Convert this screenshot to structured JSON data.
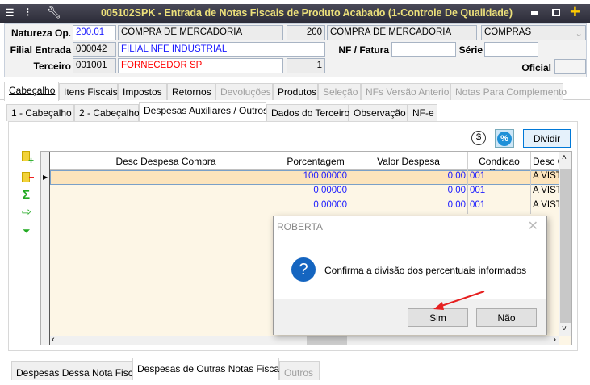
{
  "window": {
    "title": "005102SPK - Entrada de Notas Fiscais de Produto Acabado (1-Controle De Qualidade)"
  },
  "header": {
    "natureza_label": "Natureza Op.",
    "natureza_code": "200.01",
    "natureza_desc": "COMPRA DE MERCADORIA",
    "natureza_num": "200",
    "natureza_desc2": "COMPRA DE MERCADORIA",
    "natureza_group": "COMPRAS",
    "filial_label": "Filial Entrada",
    "filial_code": "000042",
    "filial_name": "FILIAL NFE INDUSTRIAL",
    "nf_label": "NF / Fatura",
    "nf_value": "",
    "serie_label": "Série",
    "serie_value": "",
    "terceiro_label": "Terceiro",
    "terceiro_code": "001001",
    "terceiro_name": "FORNECEDOR SP",
    "terceiro_num": "1",
    "oficial_label": "Oficial",
    "oficial_value": ""
  },
  "main_tabs": [
    {
      "label": "Cabeçalho"
    },
    {
      "label": "Itens Fiscais"
    },
    {
      "label": "Impostos"
    },
    {
      "label": "Retornos"
    },
    {
      "label": "Devoluções"
    },
    {
      "label": "Produtos"
    },
    {
      "label": "Seleção"
    },
    {
      "label": "NFs Versão Anterior"
    },
    {
      "label": "Notas Para Complemento"
    }
  ],
  "sub_tabs": [
    {
      "label": "1 - Cabeçalho"
    },
    {
      "label": "2 - Cabeçalho"
    },
    {
      "label": "Despesas Auxiliares / Outros"
    },
    {
      "label": "Dados do Terceiro"
    },
    {
      "label": "Observação"
    },
    {
      "label": "NF-e"
    }
  ],
  "toolbar": {
    "currency_icon": "$",
    "percent_icon": "%",
    "divide_label": "Dividir"
  },
  "grid": {
    "columns": [
      "Desc Despesa Compra",
      "Porcentagem",
      "Valor Despesa",
      "Condicao Pgto",
      "Desc C"
    ],
    "rows": [
      {
        "desc": "",
        "perc": "100.00000",
        "valor": "0.00",
        "cond": "001",
        "desc_c": "A VIST"
      },
      {
        "desc": "",
        "perc": "0.00000",
        "valor": "0.00",
        "cond": "001",
        "desc_c": "A VIST"
      },
      {
        "desc": "",
        "perc": "0.00000",
        "valor": "0.00",
        "cond": "001",
        "desc_c": "A VIST"
      }
    ]
  },
  "bottom_tabs": [
    {
      "label": "Despesas Dessa Nota Fiscal"
    },
    {
      "label": "Despesas de Outras Notas Fiscais"
    },
    {
      "label": "Outros"
    }
  ],
  "dialog": {
    "title": "ROBERTA",
    "message": "Confirma a divisão dos percentuais informados",
    "yes": "Sim",
    "no": "Não"
  },
  "colors": {
    "accent": "#1e90d8",
    "title_text": "#ece07a",
    "selected_row": "#fce4bc"
  }
}
